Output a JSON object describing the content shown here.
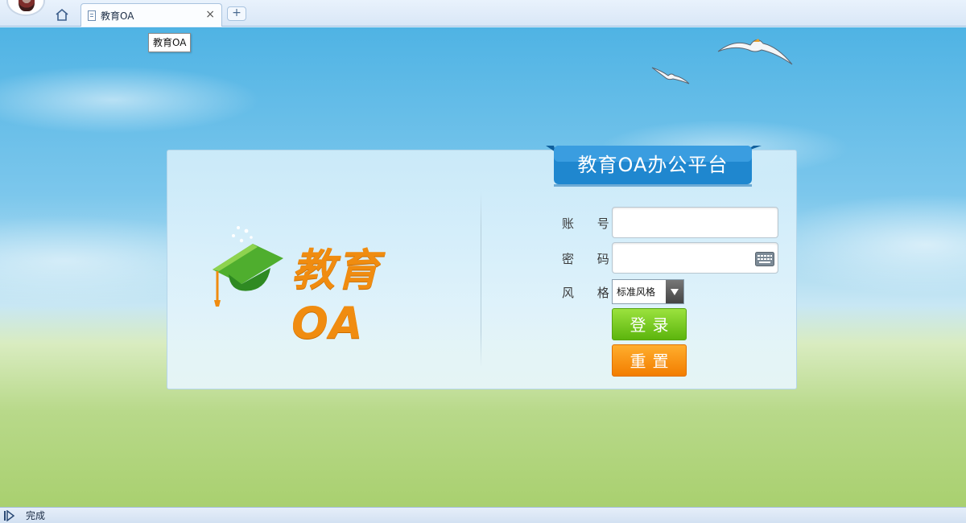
{
  "browser": {
    "tab_title": "教育OA",
    "tab_close": "×",
    "new_tab": "+",
    "tooltip": "教育OA"
  },
  "login": {
    "platform_title": "教育OA办公平台",
    "logo_text": "教育OA",
    "account_label": "账 号:",
    "password_label": "密 码:",
    "style_label": "风 格:",
    "account_value": "",
    "password_value": "",
    "style_selected": "标准风格",
    "login_button": "登录",
    "reset_button": "重置"
  },
  "status": {
    "text": "完成"
  },
  "colors": {
    "ribbon": "#1f87cf",
    "login_button": "#6cc21c",
    "reset_button": "#f58a0e",
    "logo_orange": "#f08c10",
    "cap_green": "#3a9a2a"
  },
  "icons": {
    "home": "home-icon",
    "page": "page-icon",
    "keyboard": "keyboard-icon",
    "dropdown": "dropdown-arrow-icon",
    "status": "status-play-icon"
  }
}
